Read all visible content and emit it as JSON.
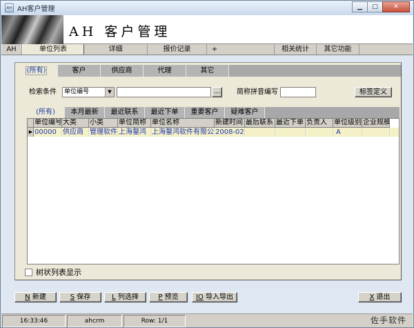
{
  "window": {
    "title": "AH客户管理",
    "app_icon": "app-icon",
    "controls": {
      "minimize": "▁",
      "maximize": "□",
      "close": "✕"
    }
  },
  "banner": {
    "title": "AH 客户管理"
  },
  "main_tabs": [
    {
      "label": "AH"
    },
    {
      "label": "单位列表"
    },
    {
      "label": "详细"
    },
    {
      "label": "报价记录"
    },
    {
      "label": "+"
    },
    {
      "label": "相关统计"
    },
    {
      "label": "其它功能"
    }
  ],
  "category_tabs": [
    {
      "label": "(所有)"
    },
    {
      "label": "客户"
    },
    {
      "label": "供应商"
    },
    {
      "label": "代理"
    },
    {
      "label": "其它"
    }
  ],
  "search": {
    "label": "检索条件",
    "field_value": "单位编号",
    "keyword_value": "",
    "more_button": "...",
    "pinyin_label": "简称拼音编写",
    "pinyin_value": "",
    "tag_button": "标签定义"
  },
  "sub_tabs": [
    {
      "label": "(所有)"
    },
    {
      "label": "本月最新"
    },
    {
      "label": "最近联系"
    },
    {
      "label": "最近下单"
    },
    {
      "label": "重要客户"
    },
    {
      "label": "疑难客户"
    }
  ],
  "grid": {
    "columns": [
      "单位编号",
      "大类",
      "小类",
      "单位简称",
      "单位名称",
      "新建时间",
      "最后联系",
      "最近下单",
      "负责人",
      "单位级别",
      "企业规模"
    ],
    "rows": [
      {
        "indicator": "▶",
        "cells": [
          "00000",
          "供应商",
          "管理软件",
          "上海鍪鸿",
          "上海鍪鸿软件有限公司",
          "2008-02-",
          "",
          "",
          "",
          "A",
          ""
        ]
      }
    ]
  },
  "tree_toggle": {
    "label": "树状列表显示",
    "checked": false
  },
  "buttons": [
    {
      "key": "N",
      "label": "新建"
    },
    {
      "key": "S",
      "label": "保存"
    },
    {
      "key": "L",
      "label": "列选择"
    },
    {
      "key": "P",
      "label": "预览"
    },
    {
      "key": "IO",
      "label": "导入导出"
    },
    {
      "key": "X",
      "label": "退出"
    }
  ],
  "status": {
    "time": "16:33:46",
    "user": "ahcrm",
    "row": "Row: 1/1"
  },
  "watermark": "佐手软件"
}
